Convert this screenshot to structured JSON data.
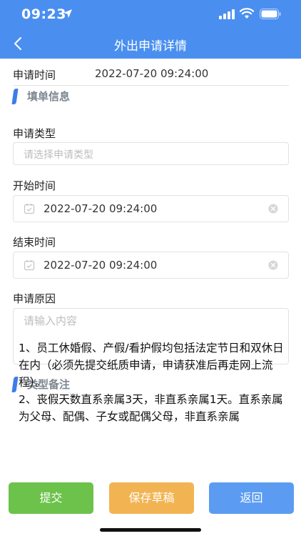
{
  "status_bar": {
    "time": "09:23"
  },
  "nav": {
    "title": "外出申请详情"
  },
  "apply_time": {
    "label": "申请时间",
    "value": "2022-07-20 09:24:00"
  },
  "form_section": {
    "title": "填单信息"
  },
  "apply_type": {
    "label": "申请类型",
    "placeholder": "请选择申请类型"
  },
  "start_time": {
    "label": "开始时间",
    "value": "2022-07-20 09:24:00"
  },
  "end_time": {
    "label": "结束时间",
    "value": "2022-07-20 09:24:00"
  },
  "reason": {
    "label": "申请原因",
    "placeholder": "请输入内容"
  },
  "notes_section": {
    "title": "类型备注"
  },
  "notes": [
    "1、员工休婚假、产假/看护假均包括法定节日和双休日在内（必须先提交纸质申请，申请获准后再走网上流程）。",
    "2、丧假天数直系亲属3天，非直系亲属1天。直系亲属为父母、配偶、子女或配偶父母，非直系亲属"
  ],
  "footer": {
    "submit_label": "提交",
    "draft_label": "保存草稿",
    "back_label": "返回"
  },
  "colors": {
    "primary": "#4a8ff0",
    "submit": "#6cc24a",
    "draft": "#f2b452",
    "back": "#5b9cf2"
  },
  "icons": [
    "location-arrow-icon",
    "signal-icon",
    "wifi-icon",
    "battery-icon",
    "back-chevron-icon",
    "calendar-icon",
    "clear-icon"
  ]
}
